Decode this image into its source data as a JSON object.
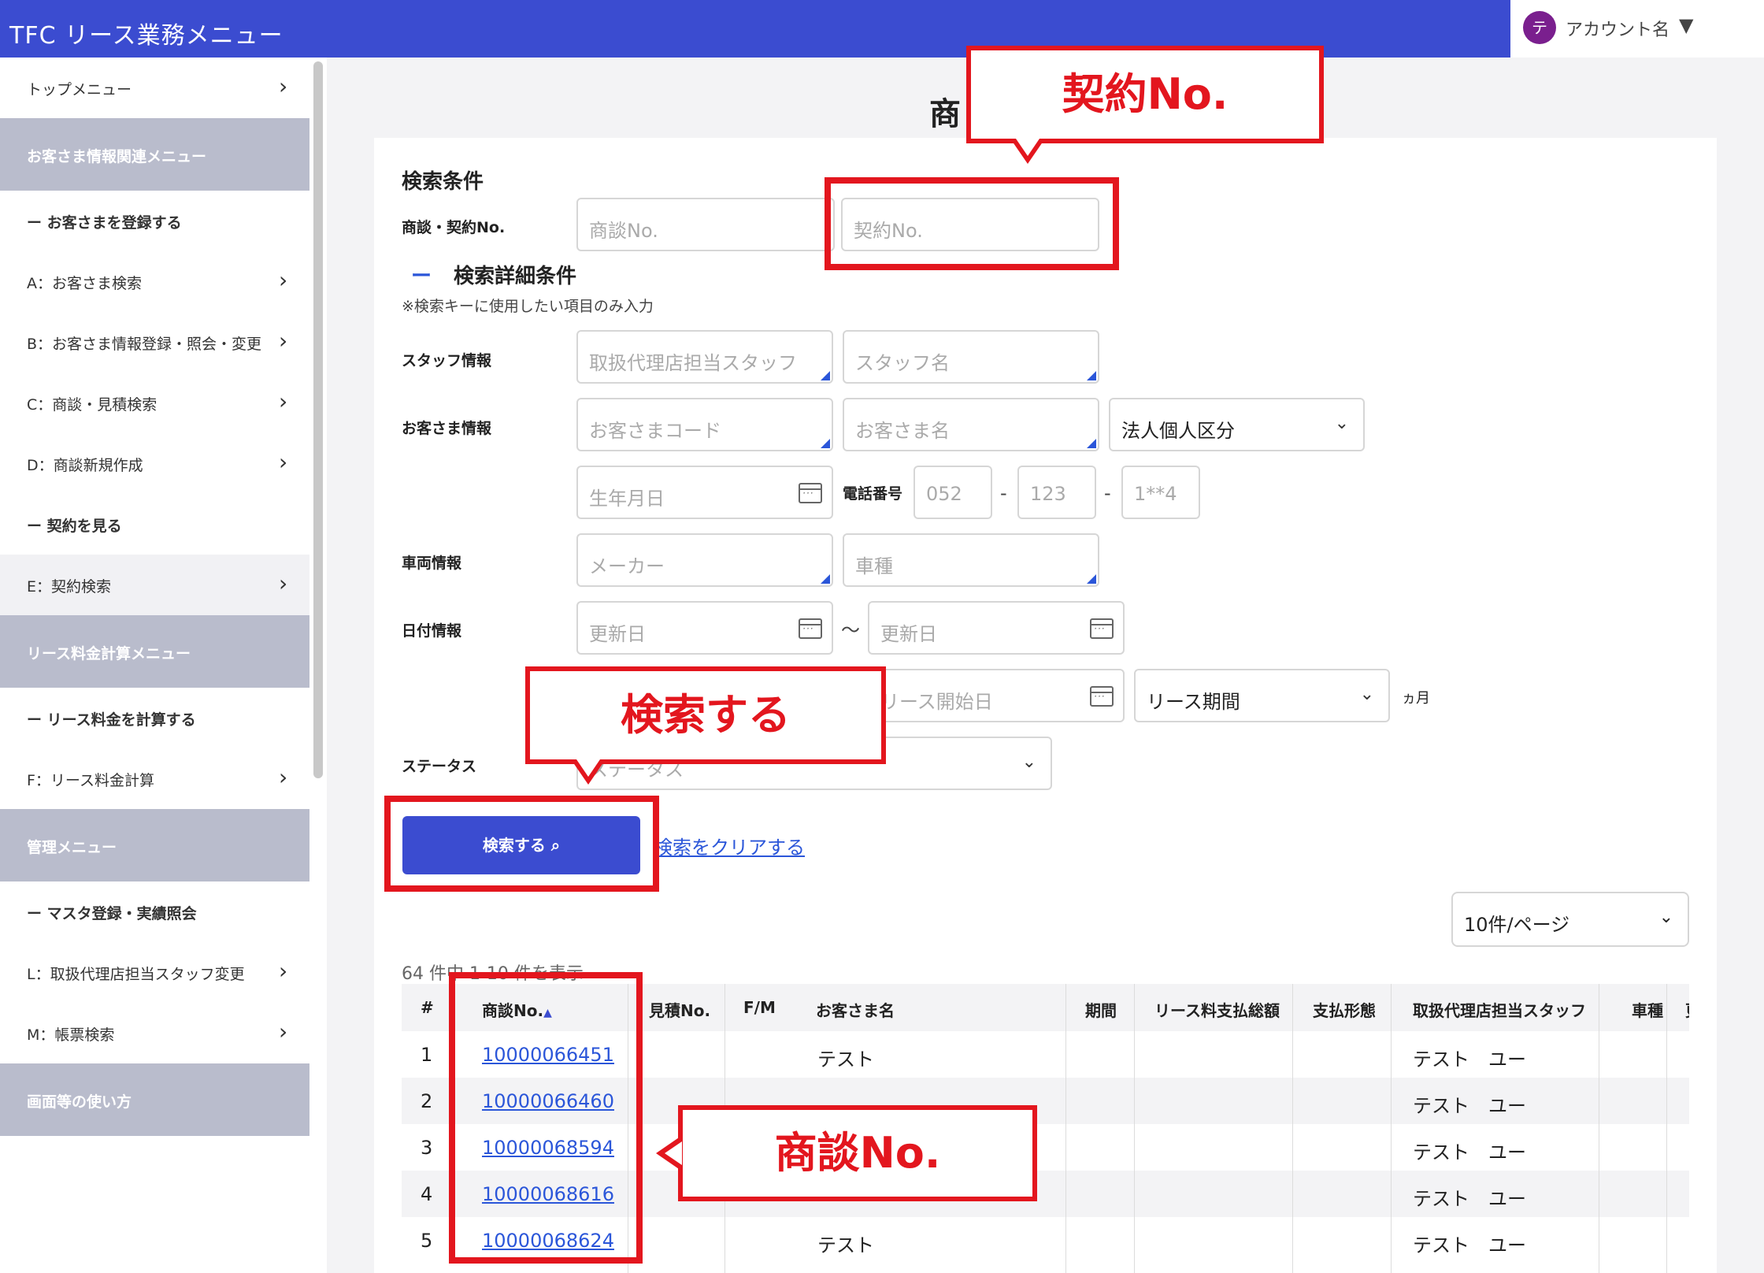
{
  "header": {
    "title": "TFC リース業務メニュー"
  },
  "account": {
    "avatar": "テ",
    "name": "アカウント名",
    "caret": "▼"
  },
  "sidebar": {
    "items": [
      {
        "label": "トップメニュー",
        "type": "link"
      },
      {
        "label": "お客さま情報関連メニュー",
        "type": "head"
      },
      {
        "label": "ー お客さまを登録する",
        "type": "bold"
      },
      {
        "label": "A：お客さま検索",
        "type": "link"
      },
      {
        "label": "B：お客さま情報登録・照会・変更",
        "type": "link"
      },
      {
        "label": "C：商談・見積検索",
        "type": "link"
      },
      {
        "label": "D：商談新規作成",
        "type": "link"
      },
      {
        "label": "ー 契約を見る",
        "type": "bold"
      },
      {
        "label": "E：契約検索",
        "type": "active"
      },
      {
        "label": "リース料金計算メニュー",
        "type": "head"
      },
      {
        "label": "ー リース料金を計算する",
        "type": "bold"
      },
      {
        "label": "F：リース料金計算",
        "type": "link"
      },
      {
        "label": "管理メニュー",
        "type": "head"
      },
      {
        "label": "ー マスタ登録・実績照会",
        "type": "bold"
      },
      {
        "label": "L：取扱代理店担当スタッフ変更",
        "type": "link"
      },
      {
        "label": "M：帳票検索",
        "type": "link"
      },
      {
        "label": "画面等の使い方",
        "type": "head"
      }
    ]
  },
  "main": {
    "page_title": "商",
    "search": {
      "title": "検索条件",
      "deal_contract_label": "商談・契約No.",
      "deal_no_placeholder": "商談No.",
      "contract_no_placeholder": "契約No.",
      "detail_toggle": "ー",
      "detail_title": "検索詳細条件",
      "detail_note": "※検索キーに使用したい項目のみ入力",
      "staff_label": "スタッフ情報",
      "staff_agent_placeholder": "取扱代理店担当スタッフ",
      "staff_name_placeholder": "スタッフ名",
      "customer_label": "お客さま情報",
      "customer_code_placeholder": "お客さまコード",
      "customer_name_placeholder": "お客さま名",
      "corp_select": "法人個人区分",
      "birth_placeholder": "生年月日",
      "phone_label": "電話番号",
      "phone1": "052",
      "phone2": "123",
      "phone3": "1**4",
      "phone_sep": "-",
      "vehicle_label": "車両情報",
      "maker_placeholder": "メーカー",
      "model_placeholder": "車種",
      "date_label": "日付情報",
      "update_from": "更新日",
      "update_to": "更新日",
      "tilde": "〜",
      "lease_start": "リース開始日",
      "lease_period": "リース期間",
      "months_unit": "ヵ月",
      "status_label": "ステータス",
      "status_placeholder": "ステータス",
      "search_button": "検索する",
      "clear_link": "検索をクリアする"
    },
    "per_page": "10件/ページ",
    "count_text": "64 件中 1-10 件を表示",
    "table": {
      "headers": [
        "#",
        "商談No.",
        "見積No.",
        "F/M",
        "お客さま名",
        "期間",
        "リース料支払総額",
        "支払形態",
        "取扱代理店担当スタッフ",
        "車種",
        "更"
      ],
      "sort_indicator": "▲",
      "rows": [
        {
          "num": "1",
          "deal": "10000066451",
          "customer": "テスト",
          "staff": "テスト　ユー"
        },
        {
          "num": "2",
          "deal": "10000066460",
          "customer": "",
          "staff": "テスト　ユー"
        },
        {
          "num": "3",
          "deal": "10000068594",
          "customer": "",
          "staff": "テスト　ユー"
        },
        {
          "num": "4",
          "deal": "10000068616",
          "customer": "",
          "staff": "テスト　ユー"
        },
        {
          "num": "5",
          "deal": "10000068624",
          "customer": "テスト",
          "staff": "テスト　ユー"
        }
      ]
    }
  },
  "annotations": {
    "contract_callout": "契約No.",
    "search_callout": "検索する",
    "deal_callout": "商談No."
  },
  "colors": {
    "brand": "#3b4cd0",
    "annotation": "#e3161e",
    "link": "#2b56d9",
    "sidebar_head": "#b9bccc"
  }
}
